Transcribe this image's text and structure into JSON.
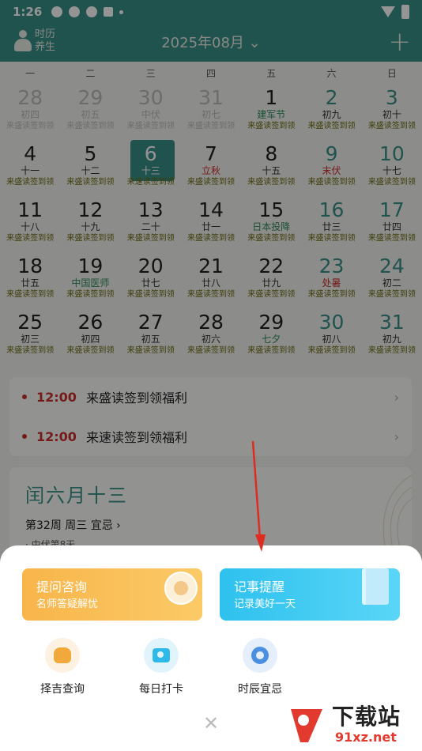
{
  "status_bar": {
    "time": "1:26",
    "extra": "A"
  },
  "header": {
    "logo_line1": "时历",
    "logo_line2": "养生",
    "month": "2025年08月",
    "month_chevron": "⌄",
    "add_label": "+"
  },
  "calendar": {
    "weekdays": [
      "一",
      "二",
      "三",
      "四",
      "五",
      "六",
      "日"
    ],
    "days": [
      {
        "num": "28",
        "lunar": "初四",
        "task": "来盛读签到领",
        "dim": true
      },
      {
        "num": "29",
        "lunar": "初五",
        "task": "来盛读签到领",
        "dim": true
      },
      {
        "num": "30",
        "lunar": "中伏",
        "task": "来盛读签到领",
        "dim": true
      },
      {
        "num": "31",
        "lunar": "初七",
        "task": "来盛读签到领",
        "dim": true
      },
      {
        "num": "1",
        "lunar": "建军节",
        "task": "来盛读签到领",
        "lunar_style": "green"
      },
      {
        "num": "2",
        "lunar": "初九",
        "task": "来盛读签到领",
        "weekend": true
      },
      {
        "num": "3",
        "lunar": "初十",
        "task": "来盛读签到领",
        "weekend": true
      },
      {
        "num": "4",
        "lunar": "十一",
        "task": "来盛读签到领"
      },
      {
        "num": "5",
        "lunar": "十二",
        "task": "来盛读签到领"
      },
      {
        "num": "6",
        "lunar": "十三",
        "task": "来速读签到领",
        "today": true
      },
      {
        "num": "7",
        "lunar": "立秋",
        "task": "来盛读签到领",
        "lunar_style": "red"
      },
      {
        "num": "8",
        "lunar": "十五",
        "task": "来盛读签到领"
      },
      {
        "num": "9",
        "lunar": "末伏",
        "task": "来盛读签到领",
        "weekend": true,
        "lunar_style": "red"
      },
      {
        "num": "10",
        "lunar": "十七",
        "task": "来盛读签到领",
        "weekend": true
      },
      {
        "num": "11",
        "lunar": "十八",
        "task": "来盛读签到领"
      },
      {
        "num": "12",
        "lunar": "十九",
        "task": "来盛读签到领"
      },
      {
        "num": "13",
        "lunar": "二十",
        "task": "来盛读签到领"
      },
      {
        "num": "14",
        "lunar": "廿一",
        "task": "来盛读签到领"
      },
      {
        "num": "15",
        "lunar": "日本投降",
        "task": "来盛读签到领",
        "lunar_style": "green"
      },
      {
        "num": "16",
        "lunar": "廿三",
        "task": "来盛读签到领",
        "weekend": true
      },
      {
        "num": "17",
        "lunar": "廿四",
        "task": "来盛读签到领",
        "weekend": true
      },
      {
        "num": "18",
        "lunar": "廿五",
        "task": "来盛读签到领"
      },
      {
        "num": "19",
        "lunar": "中国医师",
        "task": "来盛读签到领",
        "lunar_style": "green"
      },
      {
        "num": "20",
        "lunar": "廿七",
        "task": "来盛读签到领"
      },
      {
        "num": "21",
        "lunar": "廿八",
        "task": "来盛读签到领"
      },
      {
        "num": "22",
        "lunar": "廿九",
        "task": "来盛读签到领"
      },
      {
        "num": "23",
        "lunar": "处暑",
        "task": "来盛读签到领",
        "weekend": true,
        "lunar_style": "red"
      },
      {
        "num": "24",
        "lunar": "初二",
        "task": "来盛读签到领",
        "weekend": true
      },
      {
        "num": "25",
        "lunar": "初三",
        "task": "来盛读签到领"
      },
      {
        "num": "26",
        "lunar": "初四",
        "task": "来盛读签到领"
      },
      {
        "num": "27",
        "lunar": "初五",
        "task": "来盛读签到领"
      },
      {
        "num": "28",
        "lunar": "初六",
        "task": "来盛读签到领"
      },
      {
        "num": "29",
        "lunar": "七夕",
        "task": "来盛读签到领",
        "lunar_style": "green"
      },
      {
        "num": "30",
        "lunar": "初八",
        "task": "来盛读签到领",
        "weekend": true
      },
      {
        "num": "31",
        "lunar": "初九",
        "task": "来盛读签到领",
        "weekend": true
      }
    ]
  },
  "reminders": [
    {
      "time": "12:00",
      "text": "来盛读签到领福利"
    },
    {
      "time": "12:00",
      "text": "来速读签到领福利"
    }
  ],
  "almanac": {
    "lunar_date": "闰六月十三",
    "week_info": "第32周 周三 宜忌 ›",
    "solar_term": "· 中伏第8天"
  },
  "sheet": {
    "ask_card": {
      "title": "提问咨询",
      "subtitle": "名师答疑解忧"
    },
    "note_card": {
      "title": "记事提醒",
      "subtitle": "记录美好一天"
    },
    "tools": [
      {
        "label": "择吉查询",
        "icon": "lucky-jar-icon"
      },
      {
        "label": "每日打卡",
        "icon": "camera-icon"
      },
      {
        "label": "时辰宜忌",
        "icon": "clock-icon"
      }
    ],
    "close_label": "✕"
  },
  "watermark": {
    "brand": "下载站",
    "url": "91xz.net"
  },
  "colors": {
    "teal": "#3a8f87",
    "red": "#c8302b",
    "orange": "#f8b54a",
    "blue": "#2ec1ee"
  }
}
